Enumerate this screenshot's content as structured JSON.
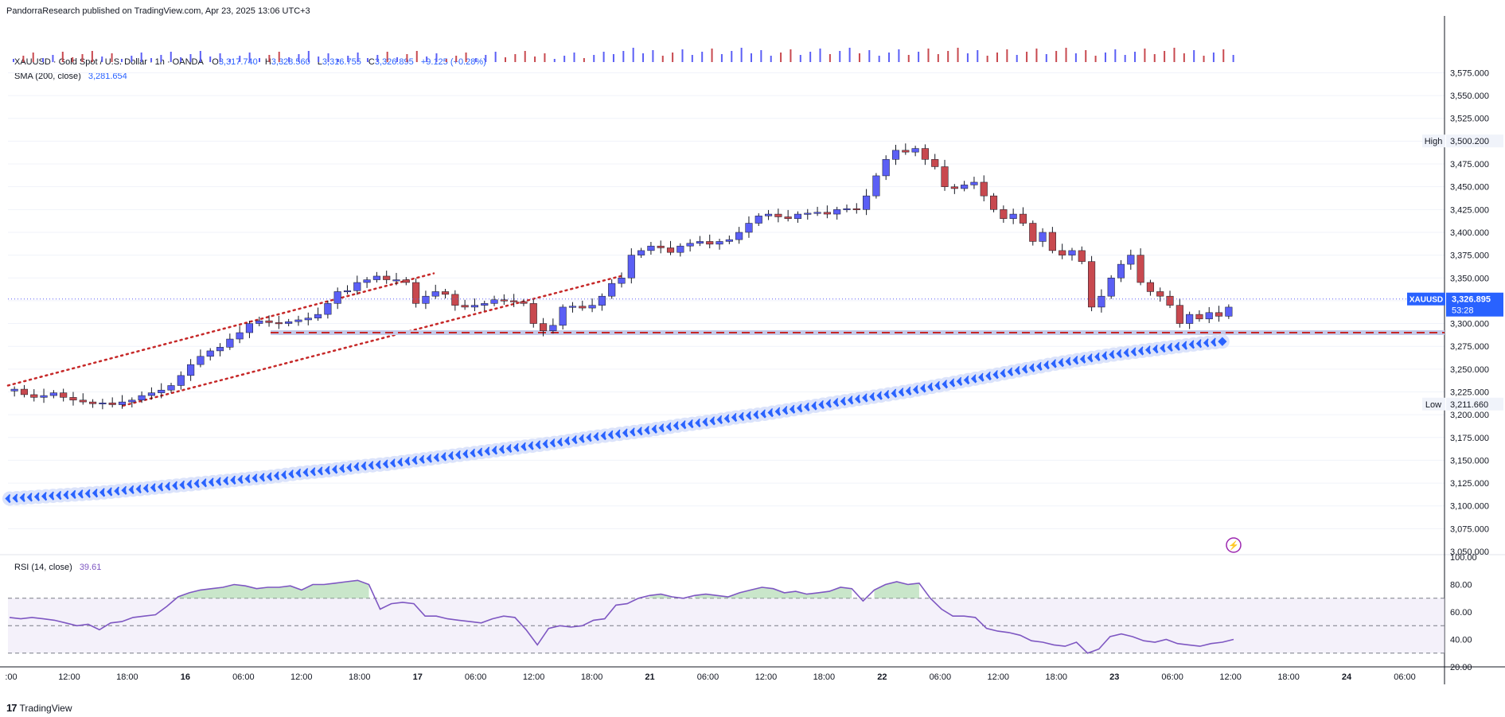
{
  "header": {
    "published": "PandorraResearch published on TradingView.com, Apr 23, 2025 13:06 UTC+3"
  },
  "legend": {
    "symbol": "XAUUSD · Gold Spot / U.S. Dollar · 1h · OANDA",
    "o_label": "O",
    "o": "3,317.740",
    "h_label": "H",
    "h": "3,328.560",
    "l_label": "L",
    "l": "3,316.755",
    "c_label": "C",
    "c": "3,326.895",
    "change": "+9.125 (+0.28%)",
    "sma_label": "SMA (200, close)",
    "sma_value": "3,281.654",
    "rsi_label": "RSI (14, close)",
    "rsi_value": "39.61"
  },
  "price_tags": {
    "high_label": "High",
    "high_value": "3,500.200",
    "low_label": "Low",
    "low_value": "3,211.660",
    "symbol_tag": "XAUUSD",
    "last_value": "3,326.895",
    "countdown": "53:28"
  },
  "footer": {
    "brand": "TradingView"
  },
  "colors": {
    "up": "#5b5ff5",
    "down": "#c8494f",
    "sma": "#2962ff",
    "rsi": "#7e57c2",
    "trend": "#c62828"
  },
  "chart_data": [
    {
      "type": "candlestick",
      "title": "XAUUSD · Gold Spot / U.S. Dollar · 1h · OANDA",
      "ylim": [
        3050,
        3585
      ],
      "yticks": [
        "3,575.000",
        "3,550.000",
        "3,525.000",
        "3,500.000",
        "3,475.000",
        "3,450.000",
        "3,425.000",
        "3,400.000",
        "3,375.000",
        "3,350.000",
        "3,325.000",
        "3,300.000",
        "3,275.000",
        "3,250.000",
        "3,225.000",
        "3,200.000",
        "3,175.000",
        "3,150.000",
        "3,125.000",
        "3,100.000",
        "3,075.000",
        "3,050.000"
      ],
      "xticks": [
        ":00",
        "12:00",
        "18:00",
        "16",
        "06:00",
        "12:00",
        "18:00",
        "17",
        "06:00",
        "12:00",
        "18:00",
        "21",
        "06:00",
        "12:00",
        "18:00",
        "22",
        "06:00",
        "12:00",
        "18:00",
        "23",
        "06:00",
        "12:00",
        "18:00",
        "24",
        "06:00"
      ],
      "close": [
        3228,
        3222,
        3219,
        3221,
        3224,
        3219,
        3216,
        3214,
        3212,
        3213,
        3211,
        3214,
        3216,
        3221,
        3224,
        3227,
        3232,
        3243,
        3255,
        3264,
        3270,
        3274,
        3283,
        3290,
        3300,
        3303,
        3301,
        3300,
        3302,
        3304,
        3306,
        3310,
        3322,
        3335,
        3336,
        3345,
        3348,
        3352,
        3348,
        3348,
        3345,
        3322,
        3330,
        3335,
        3332,
        3320,
        3318,
        3320,
        3322,
        3326,
        3325,
        3324,
        3322,
        3300,
        3292,
        3298,
        3318,
        3319,
        3317,
        3320,
        3330,
        3344,
        3350,
        3375,
        3380,
        3385,
        3383,
        3378,
        3385,
        3388,
        3390,
        3387,
        3390,
        3392,
        3400,
        3410,
        3418,
        3420,
        3417,
        3415,
        3420,
        3421,
        3422,
        3420,
        3425,
        3426,
        3425,
        3440,
        3462,
        3480,
        3490,
        3488,
        3492,
        3480,
        3472,
        3450,
        3448,
        3452,
        3455,
        3440,
        3425,
        3415,
        3420,
        3410,
        3390,
        3400,
        3380,
        3375,
        3380,
        3368,
        3318,
        3330,
        3350,
        3365,
        3375,
        3345,
        3335,
        3330,
        3320,
        3300,
        3310,
        3305,
        3312,
        3308,
        3318
      ],
      "sma200": [
        3108,
        3110,
        3112,
        3114,
        3117,
        3120,
        3123,
        3126,
        3129,
        3132,
        3136,
        3139,
        3143,
        3146,
        3150,
        3154,
        3158,
        3162,
        3166,
        3170,
        3175,
        3179,
        3183,
        3188,
        3192,
        3197,
        3201,
        3206,
        3211,
        3216,
        3221,
        3226,
        3232,
        3238,
        3244,
        3250,
        3256,
        3261,
        3266,
        3270,
        3274,
        3278,
        3281
      ],
      "volume_note": "volume bars along top edge",
      "annotations": [
        "High 3,500.200",
        "Low 3,211.660",
        "support 3,285",
        "ascending channel"
      ]
    },
    {
      "type": "line",
      "title": "RSI (14, close)",
      "ylim": [
        20,
        100
      ],
      "yticks": [
        "100.00",
        "80.00",
        "60.00",
        "40.00",
        "20.00"
      ],
      "bands": [
        70,
        50,
        30
      ],
      "values": [
        56,
        55,
        56,
        55,
        54,
        52,
        50,
        51,
        47,
        52,
        53,
        56,
        57,
        58,
        64,
        71,
        74,
        76,
        77,
        78,
        80,
        79,
        77,
        78,
        78,
        79,
        76,
        80,
        80,
        81,
        82,
        83,
        80,
        62,
        66,
        67,
        66,
        57,
        57,
        55,
        54,
        53,
        52,
        55,
        57,
        56,
        47,
        36,
        48,
        50,
        49,
        50,
        54,
        55,
        65,
        66,
        70,
        72,
        73,
        71,
        70,
        72,
        73,
        72,
        71,
        74,
        76,
        78,
        77,
        74,
        75,
        73,
        74,
        75,
        78,
        77,
        68,
        76,
        80,
        82,
        80,
        81,
        70,
        62,
        57,
        57,
        56,
        48,
        46,
        45,
        43,
        39,
        38,
        36,
        35,
        38,
        30,
        33,
        42,
        44,
        42,
        39,
        38,
        40,
        37,
        36,
        35,
        37,
        38,
        40
      ]
    }
  ]
}
